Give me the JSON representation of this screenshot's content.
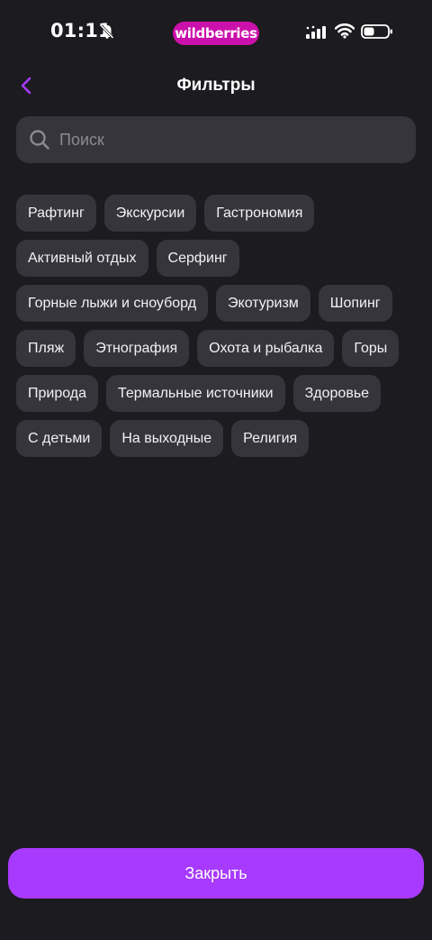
{
  "status_bar": {
    "time": "01:11",
    "brand": "wildberries",
    "brand_color": "#cb11ab",
    "icons": [
      "bell-slash-icon",
      "signal-icon",
      "wifi-icon",
      "battery-icon"
    ]
  },
  "header": {
    "title": "Фильтры",
    "back_icon": "chevron-left-icon",
    "accent_color": "#a73afd"
  },
  "search": {
    "placeholder": "Поиск",
    "value": "",
    "icon": "search-icon"
  },
  "chips": [
    "Рафтинг",
    "Экскурсии",
    "Гастрономия",
    "Активный отдых",
    "Серфинг",
    "Горные лыжи и сноуборд",
    "Экотуризм",
    "Шопинг",
    "Пляж",
    "Этнография",
    "Охота и рыбалка",
    "Горы",
    "Природа",
    "Термальные источники",
    "Здоровье",
    "С детьми",
    "На выходные",
    "Религия"
  ],
  "footer": {
    "close_label": "Закрыть"
  }
}
